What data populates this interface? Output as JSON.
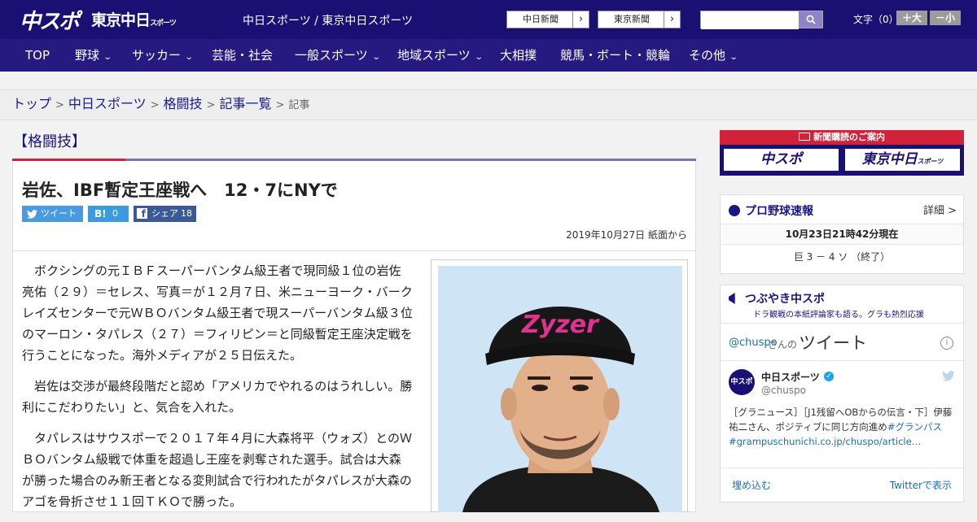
{
  "header": {
    "logo_main": "中スポ",
    "logo_sub": "東京中日",
    "logo_sub_small": "スポーツ",
    "site_name": "中日スポーツ / 東京中日スポーツ",
    "paper_links": [
      "中日新聞",
      "東京新聞"
    ],
    "arrow": "›",
    "font_label": "文字（0）",
    "font_bigger": "＋大",
    "font_smaller": "－小"
  },
  "nav": {
    "items": [
      {
        "label": "TOP",
        "dropdown": false
      },
      {
        "label": "野球",
        "dropdown": true
      },
      {
        "label": "サッカー",
        "dropdown": true
      },
      {
        "label": "芸能・社会",
        "dropdown": false
      },
      {
        "label": "一般スポーツ",
        "dropdown": true
      },
      {
        "label": "地域スポーツ",
        "dropdown": true
      },
      {
        "label": "大相撲",
        "dropdown": false
      },
      {
        "label": "競馬・ボート・競輪",
        "dropdown": false
      },
      {
        "label": "その他",
        "dropdown": true
      }
    ]
  },
  "breadcrumb": {
    "items": [
      "トップ",
      "中日スポーツ",
      "格闘技",
      "記事一覧"
    ],
    "current": "記事",
    "separator": ">"
  },
  "article": {
    "category": "【格闘技】",
    "headline": "岩佐、IBF暫定王座戦へ　12・7にNYで",
    "share": {
      "tweet_label": "ツイート",
      "hatena_label": "B!",
      "hatena_count": "0",
      "facebook_label": "シェア",
      "facebook_count": "18"
    },
    "date": "2019年10月27日 紙面から",
    "paragraphs": [
      "ボクシングの元ＩＢＦスーパーバンタム級王者で現同級１位の岩佐亮佑（２９）＝セレス、写真＝が１２月７日、米ニューヨーク・バークレイズセンターで元ＷＢＯバンタム級王者で現スーパーバンタム級３位のマーロン・タパレス（２７）＝フィリピン＝と同級暫定王座決定戦を行うことになった。海外メディアが２５日伝えた。",
      "岩佐は交渉が最終段階だと認め「アメリカでやれるのはうれしい。勝利にこだわりたい」と、気合を入れた。",
      "タパレスはサウスポーで２０１７年４月に大森将平（ウォズ）とのＷＢＯバンタム級戦で体重を超過し王座を剥奪された選手。試合は大森が勝った場合のみ新王者となる変則試合で行われたがタパレスが大森のアゴを骨折させ１１回ＴＫＯで勝った。"
    ],
    "photo_cap_text": "Zyzer"
  },
  "sidebar": {
    "ad": {
      "heading": "新聞購読のご案内",
      "logo_left": "中スポ",
      "logo_right": "東京中日",
      "logo_right_small": "スポーツ"
    },
    "baseball": {
      "title": "プロ野球速報",
      "detail_link": "詳細 >",
      "updated": "10月23日21時42分現在",
      "score": "巨 3 － 4 ソ （終了）"
    },
    "tweets": {
      "title": "つぶやき中スポ",
      "subtitle": "ドラ観戦の本紙評論家も語る。グラも熱烈応援",
      "handle_prefix": "@chuspo",
      "handle_suffix": "さんの",
      "header_big": "ツイート",
      "info_icon": "i",
      "account_name": "中日スポーツ",
      "account_handle": "@chuspo",
      "avatar_text": "中スポ",
      "tweet_text_1": "［グラニュース］［J1残留へOBからの伝言・下］伊藤祐二さん、ポジティブに同じ方向進め",
      "tweet_hashtag": "#グランパス",
      "tweet_link": "#grampuschunichi.co.jp/chuspo/article…",
      "embed_label": "埋め込む",
      "view_on_twitter": "Twitterで表示"
    }
  },
  "colors": {
    "header_bg": "#1a0f73",
    "nav_bg": "#261a80",
    "accent_red": "#d1223a",
    "twitter_blue": "#4a9ae0",
    "facebook_blue": "#3b5998"
  }
}
